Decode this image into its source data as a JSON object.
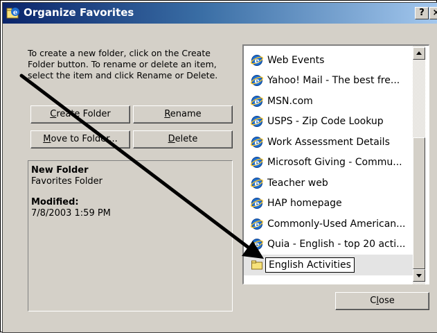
{
  "window": {
    "title": "Organize Favorites",
    "help_label": "?",
    "close_label": "×"
  },
  "instructions": "To create a new folder, click on the Create Folder button. To rename or delete an item, select the item and click Rename or Delete.",
  "buttons": {
    "create_folder": {
      "pre": "",
      "accel": "C",
      "post": "reate Folder"
    },
    "rename": {
      "pre": "",
      "accel": "R",
      "post": "ename"
    },
    "move_to_folder": {
      "pre": "",
      "accel": "M",
      "post": "ove to Folder..."
    },
    "delete": {
      "pre": "",
      "accel": "D",
      "post": "elete"
    },
    "close": {
      "pre": "C",
      "accel": "l",
      "post": "ose"
    }
  },
  "details": {
    "name": "New Folder",
    "type": "Favorites Folder",
    "modified_label": "Modified:",
    "modified_value": "7/8/2003 1:59 PM"
  },
  "favorites": [
    {
      "label": "Web Events",
      "icon": "ie-icon"
    },
    {
      "label": "Yahoo! Mail - The best fre...",
      "icon": "ie-icon"
    },
    {
      "label": "MSN.com",
      "icon": "ie-icon"
    },
    {
      "label": "USPS - Zip Code Lookup",
      "icon": "ie-icon"
    },
    {
      "label": "Work Assessment Details",
      "icon": "ie-icon"
    },
    {
      "label": "Microsoft Giving - Commu...",
      "icon": "ie-icon"
    },
    {
      "label": "Teacher web",
      "icon": "ie-icon"
    },
    {
      "label": "HAP homepage",
      "icon": "ie-icon"
    },
    {
      "label": "Commonly-Used American...",
      "icon": "ie-icon"
    },
    {
      "label": "Quia - English - top 20 acti...",
      "icon": "ie-icon"
    }
  ],
  "renaming_item": {
    "value": "English Activities",
    "icon": "folder-icon"
  },
  "colors": {
    "title_gradient_start": "#0a246a",
    "title_gradient_end": "#a6caf0",
    "dialog_face": "#d4d0c8",
    "ie_icon_blue": "#1f6fd1",
    "folder_yellow": "#f7e27b"
  }
}
